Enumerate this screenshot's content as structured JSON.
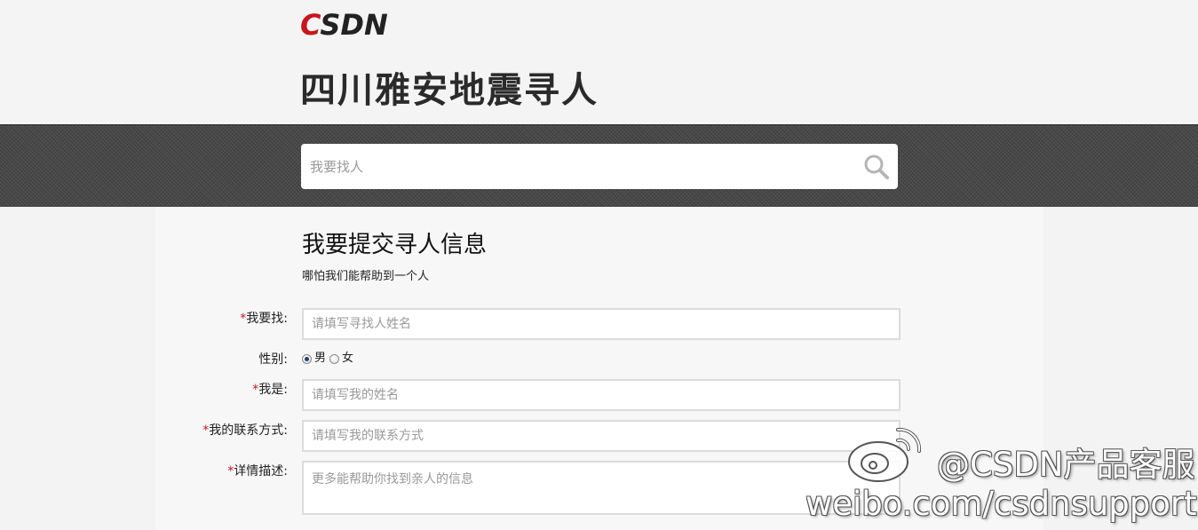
{
  "header": {
    "logo_c": "C",
    "logo_rest": "SDN",
    "site_title": "四川雅安地震寻人"
  },
  "search": {
    "placeholder": "我要找人",
    "icon": "search-icon"
  },
  "form": {
    "title": "我要提交寻人信息",
    "subtitle": "哪怕我们能帮助到一个人",
    "required_mark": "*",
    "find": {
      "label": "我要找:",
      "placeholder": "请填写寻找人姓名"
    },
    "gender": {
      "label": "性别:",
      "options": [
        {
          "label": "男",
          "checked": true
        },
        {
          "label": "女",
          "checked": false
        }
      ]
    },
    "me": {
      "label": "我是:",
      "placeholder": "请填写我的姓名"
    },
    "contact": {
      "label": "我的联系方式:",
      "placeholder": "请填写我的联系方式"
    },
    "details": {
      "label": "详情描述:",
      "placeholder": "更多能帮助你找到亲人的信息"
    }
  },
  "watermark": {
    "handle": "@CSDN产品客服",
    "url": "weibo.com/csdnsupport",
    "icon": "weibo-icon"
  },
  "colors": {
    "brand_red": "#c8161d",
    "band_dark": "#4a4a4a",
    "radio_dot": "#1f3f6e"
  }
}
